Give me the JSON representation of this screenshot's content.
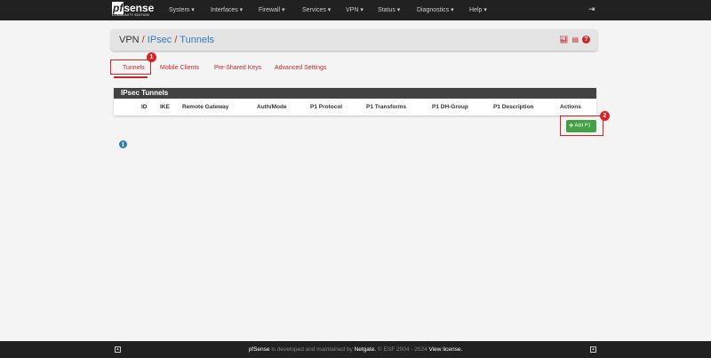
{
  "nav": {
    "logo": "pfsense",
    "logo_pf": "pf",
    "logo_sense": "sense",
    "logo_sub": "COMMUNITY EDITION",
    "menu": [
      "System ▾",
      "Interfaces ▾",
      "Firewall ▾",
      "Services ▾",
      "VPN ▾",
      "Status ▾",
      "Diagnostics ▾",
      "Help ▾"
    ],
    "logout_icon": "sign-out-icon"
  },
  "breadcrumb": {
    "items": [
      "VPN",
      "IPsec",
      "Tunnels"
    ],
    "icons": [
      "chart-icon",
      "list-icon",
      "help-icon"
    ]
  },
  "tabs": [
    "Tunnels",
    "Mobile Clients",
    "Pre-Shared Keys",
    "Advanced Settings"
  ],
  "annotations": [
    "1",
    "2"
  ],
  "panel": {
    "title": "IPsec Tunnels",
    "columns": [
      "ID",
      "IKE",
      "Remote Gateway",
      "Auth/Mode",
      "P1 Protocol",
      "P1 Transforms",
      "P1 DH-Group",
      "P1 Description",
      "Actions"
    ]
  },
  "add_button": "Add P1",
  "footer": {
    "brand": "pfSense",
    "text1": " is developed and maintained by ",
    "netgate": "Netgate.",
    "text2": " © ESF 2004 - 2024 ",
    "license": "View license."
  },
  "colors": {
    "accent": "#c62828",
    "nav": "#212121",
    "add": "#43a047",
    "link": "#2e7bbf"
  }
}
